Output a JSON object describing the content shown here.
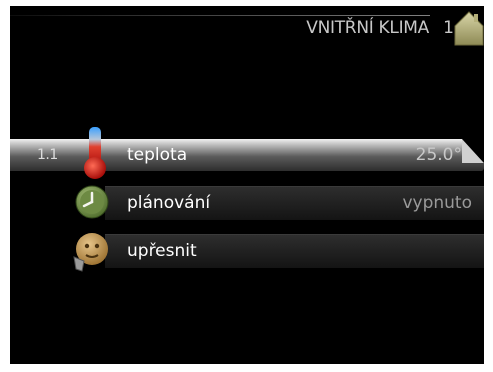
{
  "header": {
    "title": "VNITŘNÍ KLIMA",
    "menu_number": "1"
  },
  "menu_items": [
    {
      "number": "1.1",
      "label": "teplota",
      "value": "25.0°",
      "selected": true,
      "icon": "thermometer-icon"
    },
    {
      "number": "",
      "label": "plánování",
      "value": "vypnuto",
      "selected": false,
      "icon": "clock-icon"
    },
    {
      "number": "",
      "label": "upřesnit",
      "value": "",
      "selected": false,
      "icon": "settings-face-icon"
    }
  ],
  "colors": {
    "background": "#000000",
    "selected_row": "#5b5b5b",
    "text": "#ffffff",
    "value_text": "#9a9a9a",
    "home_icon": "#b5b07a"
  }
}
